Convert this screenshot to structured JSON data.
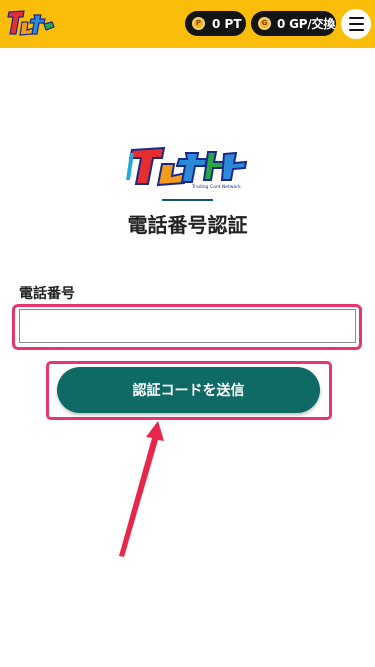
{
  "header": {
    "logo_alt": "トレネット",
    "points": {
      "icon": "p-coin-icon",
      "label": "0 PT"
    },
    "gp": {
      "icon": "gp-coin-icon",
      "label": "0 GP/交換"
    },
    "menu_icon": "hamburger-menu-icon",
    "background_color": "#f9bd0a"
  },
  "logo": {
    "name": "トレネット",
    "tagline": "Trading Card Network"
  },
  "page": {
    "title": "電話番号認証"
  },
  "form": {
    "phone_label": "電話番号",
    "phone_value": "",
    "phone_placeholder": "",
    "submit_label": "認証コードを送信"
  },
  "colors": {
    "accent_highlight": "#e8356b",
    "button": "#0f6a66",
    "arrow": "#e8264a"
  }
}
